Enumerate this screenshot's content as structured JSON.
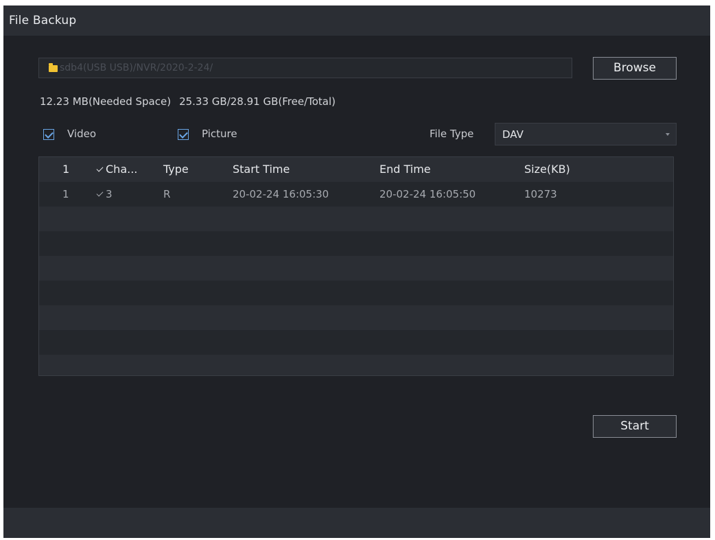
{
  "window": {
    "title": "File Backup"
  },
  "path": {
    "text": "sdb4(USB USB)/NVR/2020-2-24/"
  },
  "buttons": {
    "browse": "Browse",
    "start": "Start"
  },
  "space": {
    "needed": "12.23 MB(Needed Space)",
    "free_total": "25.33 GB/28.91 GB(Free/Total)"
  },
  "filters": {
    "video": {
      "label": "Video",
      "checked": true
    },
    "picture": {
      "label": "Picture",
      "checked": true
    },
    "file_type_label": "File Type",
    "file_type_value": "DAV"
  },
  "table": {
    "headers": {
      "index": "1",
      "channel": "Cha...",
      "type": "Type",
      "start": "Start Time",
      "end": "End Time",
      "size": "Size(KB)"
    },
    "rows": [
      {
        "index": "1",
        "channel": "3",
        "type": "R",
        "start": "20-02-24 16:05:30",
        "end": "20-02-24 16:05:50",
        "size": "10273"
      }
    ]
  },
  "colors": {
    "accent": "#6aa6e6",
    "folder": "#f1c232",
    "background": "#1f2126"
  },
  "icons": {
    "folder": "folder-icon",
    "checkbox": "checkbox-icon",
    "dropdown": "chevron-down-icon"
  }
}
